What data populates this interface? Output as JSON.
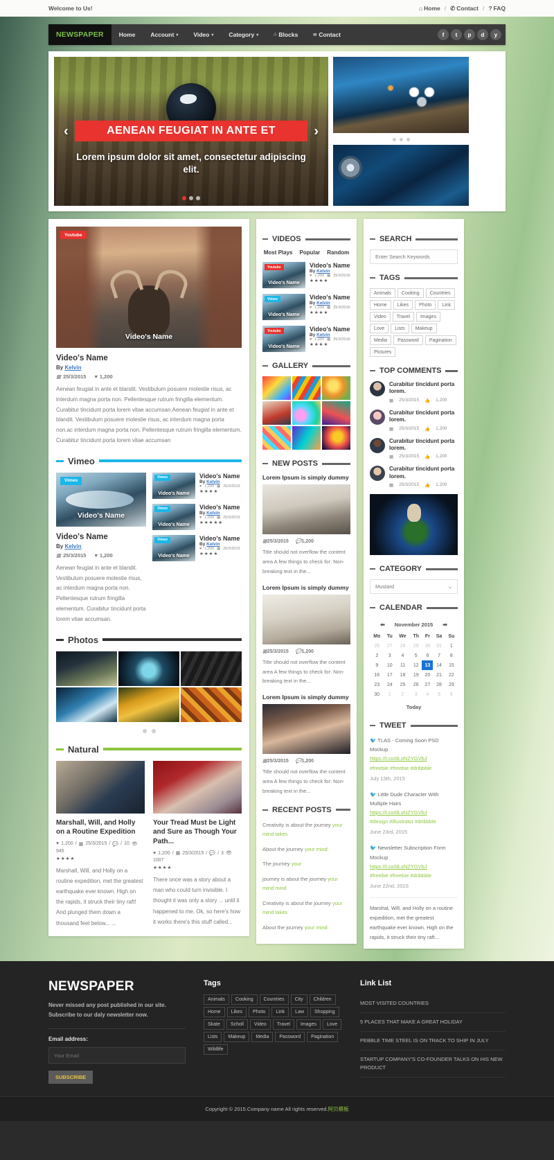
{
  "topbar": {
    "welcome": "Welcome to Us!",
    "links": [
      {
        "label": "Home",
        "icon": "home-icon"
      },
      {
        "label": "Contact",
        "icon": "phone-icon"
      },
      {
        "label": "FAQ",
        "icon": "question-icon"
      }
    ],
    "separator": "/"
  },
  "nav": {
    "brand": "NEWSPAPER",
    "brand_color": "#7ec04a",
    "items": [
      {
        "label": "Home",
        "caret": false,
        "icon": ""
      },
      {
        "label": "Account",
        "caret": true,
        "icon": ""
      },
      {
        "label": "Video",
        "caret": true,
        "icon": ""
      },
      {
        "label": "Category",
        "caret": true,
        "icon": ""
      },
      {
        "label": "Blocks",
        "caret": false,
        "icon": "blocks-icon"
      },
      {
        "label": "Contact",
        "caret": false,
        "icon": "envelope-icon"
      }
    ],
    "social": [
      {
        "name": "facebook-icon",
        "glyph": "f"
      },
      {
        "name": "twitter-icon",
        "glyph": "t"
      },
      {
        "name": "pinterest-icon",
        "glyph": "p"
      },
      {
        "name": "dribbble-icon",
        "glyph": "d"
      },
      {
        "name": "youtube-icon",
        "glyph": "y"
      }
    ]
  },
  "slider": {
    "title": "AENEAN FEUGIAT IN ANTE ET",
    "subtitle": "Lorem ipsum dolor sit amet, consectetur adipiscing elit.",
    "prev": "‹",
    "next": "›",
    "dots_total": 3,
    "dots_active": 0,
    "side_dots_total": 3
  },
  "featured": {
    "badge": "Youtube",
    "thumb_caption": "Video's Name",
    "title": "Video's Name",
    "by_prefix": "By ",
    "author": "Kelvin",
    "date": "25/3/2015",
    "likes": "1,200",
    "excerpt": "Aenean feugiat in ante et blandit. Vestibulum posuere molestie risus, ac interdum magna porta non. Pellentesque rutrum fringilla elementum. Curabitur tincidunt porta lorem vitae accumsan.Aenean feugiat in ante et blandit. Vestibulum posuere molestie risus, ac interdum magna porta non.ac interdum magna porta non. Pellentesque rutrum fringilla elementum. Curabitur tincidunt porta lorem vitae accumsan"
  },
  "vimeo_section": {
    "heading": "Vimeo",
    "accent": "#1ab7ea",
    "main": {
      "badge": "Vimeo",
      "thumb_caption": "Video's Name",
      "title": "Video's Name",
      "by_prefix": "By ",
      "author": "Kelvin",
      "date": "25/3/2015",
      "likes": "1,200",
      "excerpt": "Aenean feugiat in ante et blandit. Vestibulum posuere molestie risus, ac interdum magna porta non. Pellentesque rutrum fringilla elementum. Curabitur tincidunt porta lorem vitae accumsan."
    },
    "items": [
      {
        "badge": "Vimeo",
        "thumb_caption": "Video's Name",
        "title": "Video's Name",
        "by_prefix": "By ",
        "author": "Kelvin",
        "likes": "1,200",
        "date": "25/3/2015",
        "stars": "★★★★",
        "half": "1"
      },
      {
        "badge": "Vimeo",
        "thumb_caption": "Video's Name",
        "title": "Video's Name",
        "by_prefix": "By ",
        "author": "Kelvin",
        "likes": "1,200",
        "date": "25/3/2015",
        "stars": "★★★★★",
        "half": ""
      },
      {
        "badge": "Vimeo",
        "thumb_caption": "Video's Name",
        "title": "Video's Name",
        "by_prefix": "By ",
        "author": "Kelvin",
        "likes": "1,200",
        "date": "25/3/2015",
        "stars": "★★★★",
        "half": "1"
      }
    ]
  },
  "photos_section": {
    "heading": "Photos",
    "dots_total": 2
  },
  "natural_section": {
    "heading": "Natural",
    "accent": "#8cc63e",
    "articles": [
      {
        "title": "Marshall, Will, and Holly on a Routine Expedition",
        "likes": "1,200",
        "date": "25/3/2015",
        "comments": "10",
        "views": "945",
        "stars": "★★★★",
        "half": "1",
        "excerpt": "Marshall, Will, and Holly on a routine expedition, met the greatest earthquake ever known. High on the rapids, it struck their tiny raft! And plunged them down a thousand feet below... ..."
      },
      {
        "title": "Your Tread Must be Light and Sure as Though Your Path...",
        "likes": "1,200",
        "date": "25/3/2015",
        "comments": "3",
        "views": "1007",
        "stars": "★★★★",
        "half": "1",
        "excerpt": "There once was a story about a man who could turn invisible. I thought it was only a story ... until it happened to me. Ok, so here's how it works there's this stuff called..."
      }
    ]
  },
  "videos_widget": {
    "heading": "VIDEOS",
    "tabs": [
      "Most Plays",
      "Popular",
      "Random"
    ],
    "items": [
      {
        "badge": "Youtube",
        "thumb_caption": "Video's Name",
        "title": "Video's Name",
        "by_prefix": "By ",
        "author": "Kelvin",
        "likes": "1,200",
        "date": "25/3/2016",
        "stars": "★★★★",
        "half": "1"
      },
      {
        "badge": "Vimeo",
        "thumb_caption": "Video's Name",
        "title": "Video's Name",
        "by_prefix": "By ",
        "author": "Kelvin",
        "likes": "1,200",
        "date": "25/3/2016",
        "stars": "★★★★",
        "half": "1"
      },
      {
        "badge": "Youtube",
        "thumb_caption": "Video's Name",
        "title": "Video's Name",
        "by_prefix": "By ",
        "author": "Kelvin",
        "likes": "1,200",
        "date": "25/3/2016",
        "stars": "★★★★",
        "half": "1"
      }
    ]
  },
  "gallery_widget": {
    "heading": "GALLERY"
  },
  "new_posts_widget": {
    "heading": "NEW POSTS",
    "items": [
      {
        "title": "Lorem Ipsum is simply dummy",
        "date": "25/3/2015",
        "comments": "1,200",
        "excerpt": "Title should not overflow the content area A few things to check for: Non-breaking text in the..."
      },
      {
        "title": "Lorem Ipsum is simply dummy",
        "date": "25/3/2015",
        "comments": "1,200",
        "excerpt": "Title should not overflow the content area A few things to check for: Non-breaking text in the..."
      },
      {
        "title": "Lorem Ipsum is simply dummy",
        "date": "25/3/2015",
        "comments": "1,200",
        "excerpt": "Title should not overflow the content area A few things to check for: Non-breaking text in the..."
      }
    ]
  },
  "recent_posts_widget": {
    "heading": "RECENT POSTS",
    "items": [
      {
        "text": "Creativity is about the journey ",
        "highlight": "your mind takes"
      },
      {
        "text": "About the journey ",
        "highlight": "your mind"
      },
      {
        "text": "The journey ",
        "highlight": "your"
      },
      {
        "text": "journey is about the journey ",
        "highlight": "your mind mind"
      },
      {
        "text": "Creativity is about the journey ",
        "highlight": "your mind takes"
      },
      {
        "text": "About the journey ",
        "highlight": "your mind"
      }
    ]
  },
  "search_widget": {
    "heading": "SEARCH",
    "placeholder": "Enter Search Keywords",
    "value": ""
  },
  "tags_widget": {
    "heading": "TAGS",
    "tags": [
      "Animals",
      "Cooking",
      "Countries",
      "Home",
      "Likes",
      "Photo",
      "Link",
      "Video",
      "Travel",
      "Images",
      "Love",
      "Lists",
      "Makeup",
      "Media",
      "Password",
      "Pagination",
      "Pictures"
    ]
  },
  "top_comments_widget": {
    "heading": "TOP COMMENTS",
    "items": [
      {
        "text": "Curabitur tincidunt porta lorem.",
        "date": "25/3/2015",
        "likes": "1,200"
      },
      {
        "text": "Curabitur tincidunt porta lorem.",
        "date": "25/3/2015",
        "likes": "1,200"
      },
      {
        "text": "Curabitur tincidunt porta lorem.",
        "date": "25/3/2015",
        "likes": "1,200"
      },
      {
        "text": "Curabitur tincidunt porta lorem.",
        "date": "25/3/2015",
        "likes": "1,200"
      }
    ]
  },
  "category_widget": {
    "heading": "CATEGORY",
    "selected": "Mustard"
  },
  "calendar_widget": {
    "heading": "CALENDAR",
    "prev_icon": "arrow-left-icon",
    "next_icon": "arrow-right-icon",
    "month": "November 2015",
    "weekdays": [
      "Mo",
      "Tu",
      "We",
      "Th",
      "Fr",
      "Sa",
      "Su"
    ],
    "weeks": [
      [
        {
          "d": "26",
          "mut": true
        },
        {
          "d": "27",
          "mut": true
        },
        {
          "d": "28",
          "mut": true
        },
        {
          "d": "29",
          "mut": true
        },
        {
          "d": "30",
          "mut": true
        },
        {
          "d": "31",
          "mut": true
        },
        {
          "d": "1",
          "mut": false
        }
      ],
      [
        {
          "d": "2",
          "mut": false
        },
        {
          "d": "3",
          "mut": false
        },
        {
          "d": "4",
          "mut": false
        },
        {
          "d": "5",
          "mut": false
        },
        {
          "d": "6",
          "mut": false
        },
        {
          "d": "7",
          "mut": false
        },
        {
          "d": "8",
          "mut": false
        }
      ],
      [
        {
          "d": "9",
          "mut": false
        },
        {
          "d": "10",
          "mut": false
        },
        {
          "d": "11",
          "mut": false
        },
        {
          "d": "12",
          "mut": false
        },
        {
          "d": "13",
          "mut": false,
          "on": true
        },
        {
          "d": "14",
          "mut": false
        },
        {
          "d": "15",
          "mut": false
        }
      ],
      [
        {
          "d": "16",
          "mut": false
        },
        {
          "d": "17",
          "mut": false
        },
        {
          "d": "18",
          "mut": false
        },
        {
          "d": "19",
          "mut": false
        },
        {
          "d": "20",
          "mut": false
        },
        {
          "d": "21",
          "mut": false
        },
        {
          "d": "22",
          "mut": false
        }
      ],
      [
        {
          "d": "23",
          "mut": false
        },
        {
          "d": "24",
          "mut": false
        },
        {
          "d": "25",
          "mut": false
        },
        {
          "d": "26",
          "mut": false
        },
        {
          "d": "27",
          "mut": false
        },
        {
          "d": "28",
          "mut": false
        },
        {
          "d": "29",
          "mut": false
        }
      ],
      [
        {
          "d": "30",
          "mut": false
        },
        {
          "d": "1",
          "mut": true
        },
        {
          "d": "2",
          "mut": true
        },
        {
          "d": "3",
          "mut": true
        },
        {
          "d": "4",
          "mut": true
        },
        {
          "d": "5",
          "mut": true
        },
        {
          "d": "6",
          "mut": true
        }
      ]
    ],
    "today_label": "Today"
  },
  "tweet_widget": {
    "heading": "TWEET",
    "items": [
      {
        "text": "TLAS - Coming Soon PSD Mockup",
        "link": "https://t.co/dLsNZYGVbJ",
        "hashtags": "#freebie #freebie #dribbble",
        "date": "July 15th, 2015"
      },
      {
        "text": "Little Dude Character With Multiple Hairs",
        "link": "https://t.co/dLsNZYGVbJ",
        "hashtags": "#design #illustrator #dribbble",
        "date": "June 23rd, 2015"
      },
      {
        "text": "Newsletter Subscription Form Mockup",
        "link": "https://t.co/dLsNZYGVbJ",
        "hashtags": "#freebie #freebie #dribbble",
        "date": "June 22nd, 2015"
      }
    ],
    "plain_text": "Marshal, Will, and Holly on a routine expedition, met the greatest earthquake ever known. High on the rapids, it struck their tiny raft..."
  },
  "footer": {
    "brand": "NEWSPAPER",
    "tagline": "Never missed any post published in our site. Subscribe to our daly newsletter now.",
    "email_label": "Email address:",
    "email_placeholder": "Your Email",
    "email_value": "",
    "subscribe_label": "SUBSCRIBE",
    "tags_heading": "Tags",
    "tags": [
      "Animals",
      "Cooking",
      "Countries",
      "City",
      "Children",
      "Home",
      "Likes",
      "Photo",
      "Link",
      "Law",
      "Shopping",
      "Skate",
      "Scholl",
      "Video",
      "Travel",
      "Images",
      "Love",
      "Lists",
      "Makeup",
      "Media",
      "Password",
      "Pagination",
      "Wildlife"
    ],
    "links_heading": "Link List",
    "links": [
      "MOST VISITED COUNTRIES",
      "5 PLACES THAT MAKE A GREAT HOLIDAY",
      "PEBBLE TIME STEEL IS ON TRACK TO SHIP IN JULY",
      "STARTUP COMPANY'S CO-FOUNDER TALKS ON HIS NEW PRODUCT"
    ],
    "copyright": "Copyright © 2015.Company name All rights reserved.",
    "copyright_brand": "阿贝模板"
  }
}
